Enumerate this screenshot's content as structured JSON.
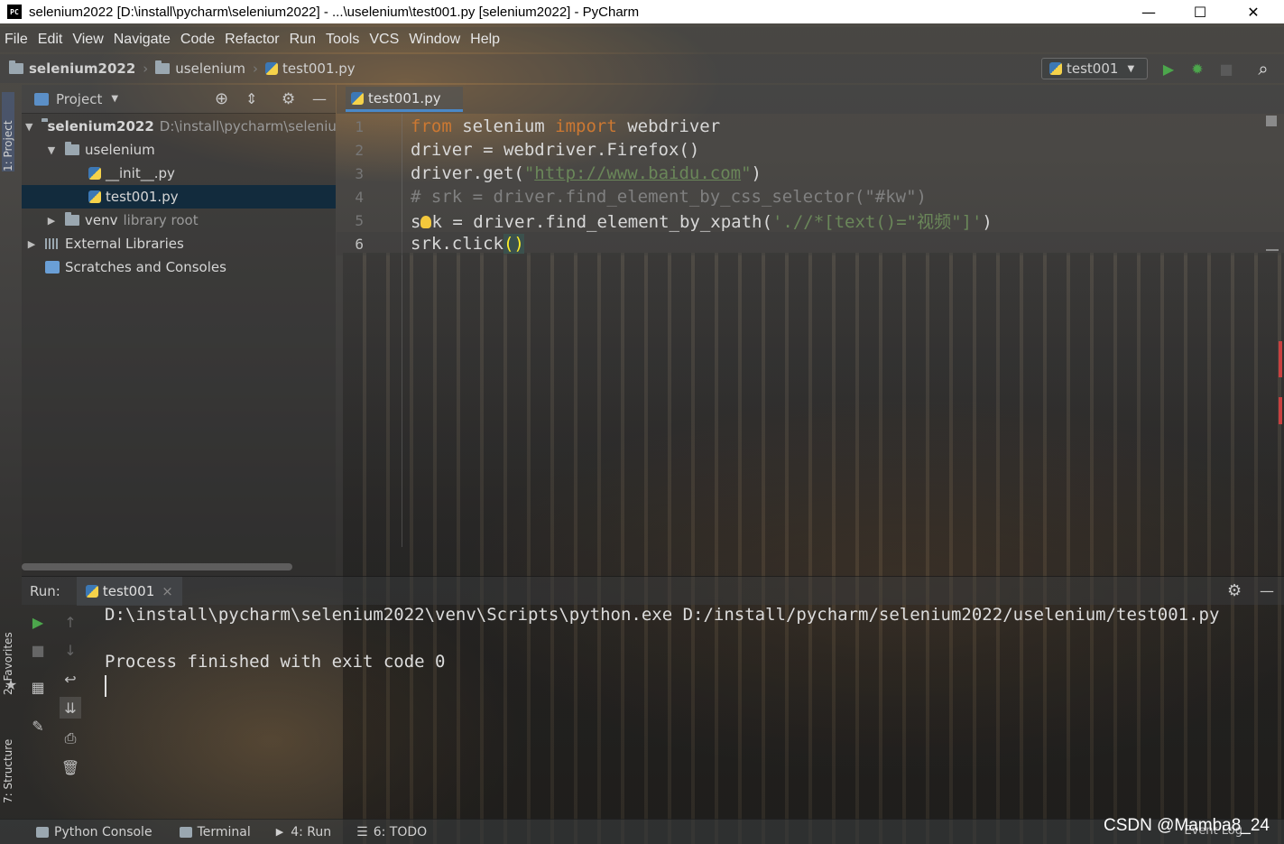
{
  "window": {
    "title": "selenium2022 [D:\\install\\pycharm\\selenium2022] - ...\\uselenium\\test001.py [selenium2022] - PyCharm",
    "logo_text": "PC",
    "minimize": "—",
    "maximize": "☐",
    "close": "✕"
  },
  "menu": [
    "File",
    "Edit",
    "View",
    "Navigate",
    "Code",
    "Refactor",
    "Run",
    "Tools",
    "VCS",
    "Window",
    "Help"
  ],
  "breadcrumb": {
    "project": "selenium2022",
    "folder": "uselenium",
    "file": "test001.py",
    "separator": "›"
  },
  "toolbar": {
    "run_config": "test001",
    "dropdown_icon": "▼",
    "run_icon": "▶",
    "debug_icon": "✹",
    "stop_icon": "■",
    "search_icon": "⌕"
  },
  "left_stripe": {
    "project_tab": "1: Project",
    "favorites_tab": "2: Favorites",
    "structure_tab": "7: Structure"
  },
  "project_panel": {
    "header": "Project",
    "dropdown": "▼",
    "locate_icon": "⊕",
    "collapse_icon": "⇕",
    "settings_icon": "⚙",
    "hide_icon": "—",
    "tree": [
      {
        "label": "selenium2022",
        "suffix": "D:\\install\\pycharm\\seleniu",
        "arrow": "▼"
      },
      {
        "label": "uselenium",
        "suffix": "",
        "arrow": "▼"
      },
      {
        "label": "__init__.py",
        "suffix": "",
        "arrow": ""
      },
      {
        "label": "test001.py",
        "suffix": "",
        "arrow": ""
      },
      {
        "label": "venv",
        "suffix": "library root",
        "arrow": "▶"
      },
      {
        "label": "External Libraries",
        "suffix": "",
        "arrow": "▶"
      },
      {
        "label": "Scratches and Consoles",
        "suffix": "",
        "arrow": ""
      }
    ]
  },
  "editor": {
    "tab": "test001.py",
    "lines": [
      {
        "num": "1"
      },
      {
        "num": "2"
      },
      {
        "num": "3"
      },
      {
        "num": "4"
      },
      {
        "num": "5"
      },
      {
        "num": "6"
      }
    ],
    "code": {
      "l1_kw1": "from",
      "l1_mid": " selenium ",
      "l1_kw2": "import",
      "l1_end": " webdriver",
      "l2": "driver = webdriver.Firefox()",
      "l3_a": "driver.get(",
      "l3_q1": "\"",
      "l3_url": "http://www.baidu.com",
      "l3_q2": "\"",
      "l3_b": ")",
      "l4": "# srk = driver.find_element_by_css_selector(\"#kw\")",
      "l5_a": "s",
      "l5_b": "k = driver.find_element_by_xpath(",
      "l5_str": "'.//*[text()=\"视频\"]'",
      "l5_c": ")",
      "l6_a": "srk.click",
      "l6_b": "()"
    }
  },
  "run_panel": {
    "label": "Run:",
    "tab": "test001",
    "tab_close": "×",
    "settings_icon": "⚙",
    "hide_icon": "—",
    "console": [
      "D:\\install\\pycharm\\selenium2022\\venv\\Scripts\\python.exe D:/install/pycharm/selenium2022/uselenium/test001.py",
      "",
      "Process finished with exit code 0"
    ]
  },
  "bottom_bar": {
    "python_console": "Python Console",
    "terminal": "Terminal",
    "run": "4: Run",
    "todo": "6: TODO",
    "event_log": "Event Log",
    "watermark": "CSDN @Mamba8_24"
  },
  "colors": {
    "keyword": "#cc7832",
    "string": "#6a8759",
    "comment": "#808080",
    "selection": "#0d293e",
    "accent": "#4a88c7"
  }
}
